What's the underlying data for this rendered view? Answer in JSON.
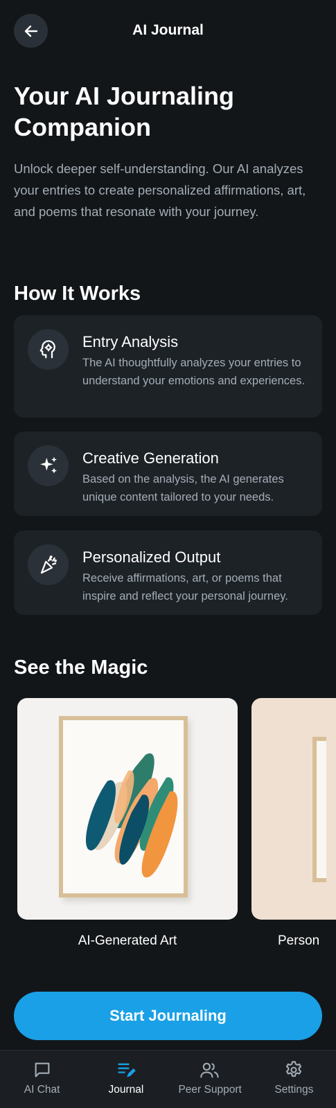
{
  "header": {
    "title": "AI Journal"
  },
  "hero": {
    "title": "Your AI Journaling Companion",
    "description": "Unlock deeper self-understanding. Our AI analyzes your entries to create personalized affirmations, art, and poems that resonate with your journey."
  },
  "how_it_works": {
    "title": "How It Works",
    "steps": [
      {
        "icon": "brain-gear-icon",
        "title": "Entry Analysis",
        "description": "The AI thoughtfully analyzes your entries to understand your emotions and experiences."
      },
      {
        "icon": "sparkles-icon",
        "title": "Creative Generation",
        "description": "Based on the analysis, the AI generates unique content tailored to your needs."
      },
      {
        "icon": "party-popper-icon",
        "title": "Personalized Output",
        "description": "Receive affirmations, art, or poems that inspire and reflect your personal journey."
      }
    ]
  },
  "magic": {
    "title": "See the Magic",
    "slides": [
      {
        "caption": "AI-Generated Art"
      },
      {
        "caption": "Person"
      }
    ]
  },
  "cta": {
    "label": "Start Journaling"
  },
  "nav": {
    "items": [
      {
        "label": "AI Chat",
        "icon": "chat-bubble-icon",
        "active": false
      },
      {
        "label": "Journal",
        "icon": "journal-edit-icon",
        "active": true
      },
      {
        "label": "Peer Support",
        "icon": "people-icon",
        "active": false
      },
      {
        "label": "Settings",
        "icon": "gear-icon",
        "active": false
      }
    ]
  },
  "colors": {
    "accent": "#1aa0e6",
    "background": "#121619",
    "card": "#1d2227",
    "muted_text": "#a4adb6"
  }
}
